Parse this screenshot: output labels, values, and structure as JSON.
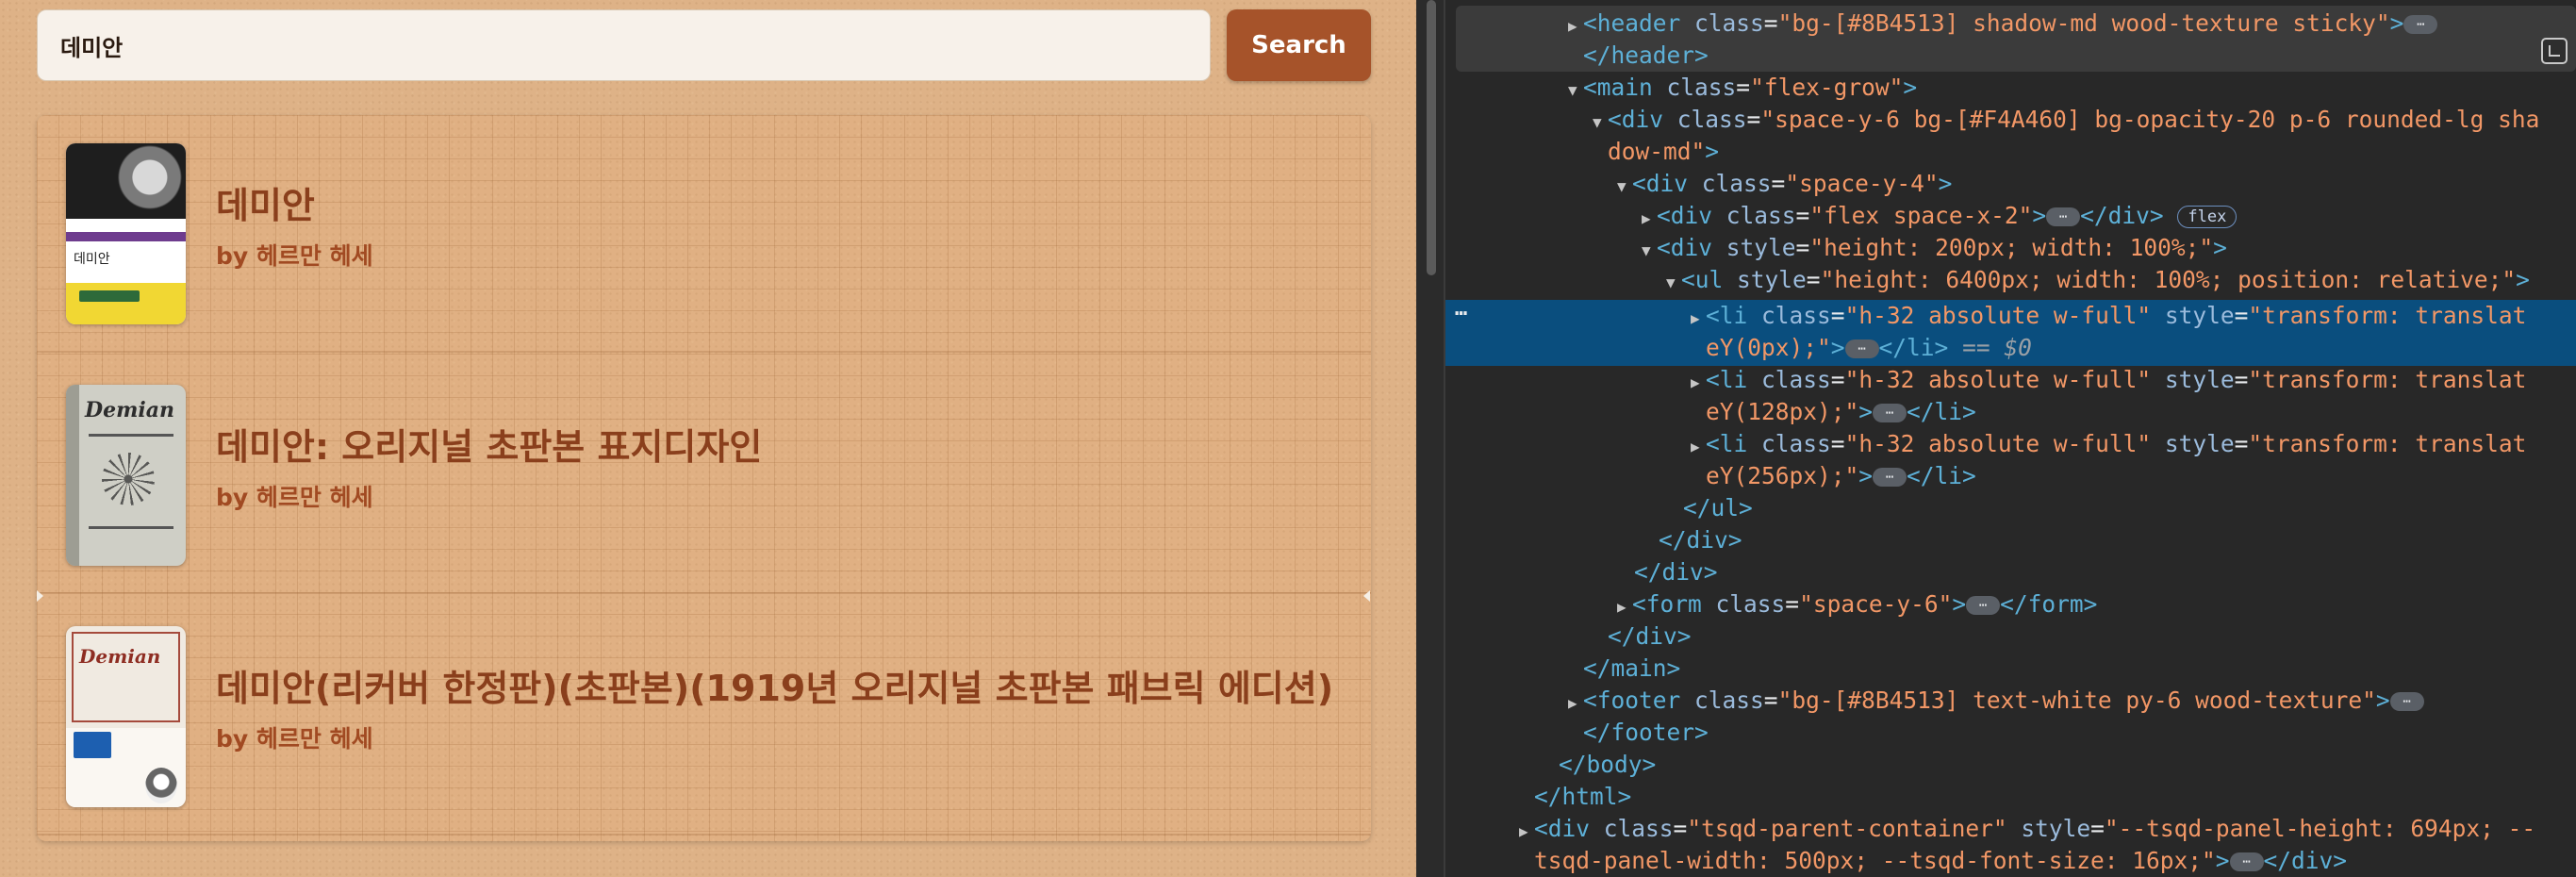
{
  "search": {
    "value": "데미안",
    "button_label": "Search"
  },
  "results": [
    {
      "title": "데미안",
      "author": "by 헤르만 헤세",
      "cover_icon": "book-cover-image"
    },
    {
      "title": "데미안: 오리지널 초판본 표지디자인",
      "author": "by 헤르만 헤세",
      "cover_icon": "book-cover-image"
    },
    {
      "title": "데미안(리커버 한정판)(초판본)(1919년 오리지널 초판본 패브릭 에디션)",
      "author": "by 헤르만 헤세",
      "cover_icon": "book-cover-image"
    }
  ],
  "covers": {
    "cover1_title": "데미안",
    "cover2_word": "Demian",
    "cover3_word": "Demian"
  },
  "devtools": {
    "header_open": "<header",
    "header_class_attr": "class",
    "header_class_val": "\"bg-[#8B4513] shadow-md wood-texture sticky\"",
    "header_close": "</header>",
    "main_open": "<main",
    "main_class_val": "\"flex-grow\"",
    "div1_class_val": "\"space-y-6 bg-[#F4A460] bg-opacity-20 p-6 rounded-lg sha",
    "div1_class_val_2": "dow-md\"",
    "div2_class_val": "\"space-y-4\"",
    "div3_class_val": "\"flex space-x-2\"",
    "div3_badge": "flex",
    "div4_style_val": "\"height: 200px; width: 100%;\"",
    "ul_style_val": "\"height: 6400px; width: 100%; position: relative;\"",
    "li_class_val": "\"h-32 absolute w-full\"",
    "li1_style_1": "\"transform: translat",
    "li1_style_2": "eY(0px);\"",
    "li2_style_2": "eY(128px);\"",
    "li3_style_2": "eY(256px);\"",
    "dollar0": "== $0",
    "ul_close": "</ul>",
    "div_close": "</div>",
    "form_class_val": "\"space-y-6\"",
    "main_close": "</main>",
    "footer_class_val": "\"bg-[#8B4513] text-white py-6 wood-texture\"",
    "footer_close": "</footer>",
    "body_close": "</body>",
    "html_close": "</html>",
    "tsqd_class_val": "\"tsqd-parent-container\"",
    "tsqd_style_1": "\"--tsqd-panel-height: 694px; --",
    "tsqd_style_2": "tsqd-panel-width: 500px; --tsqd-font-size: 16px;\"",
    "ellipsis": "⋯",
    "gutter_dots": "⋯"
  }
}
